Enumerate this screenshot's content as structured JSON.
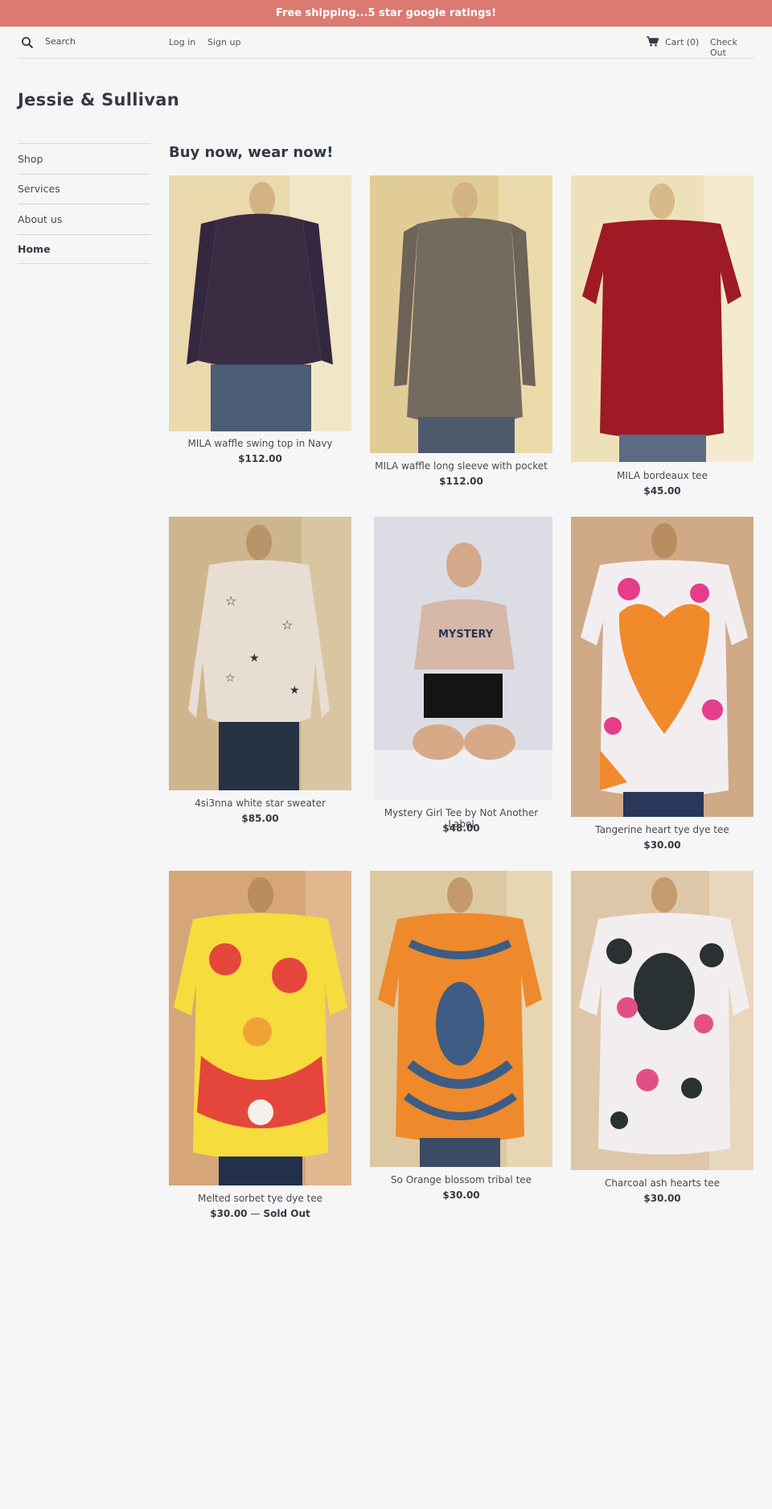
{
  "announcement": "Free shipping...5 star google ratings!",
  "header": {
    "search_label": "Search",
    "login": "Log in",
    "signup": "Sign up",
    "cart": "Cart (0)",
    "checkout": "Check Out",
    "icons": {
      "search": "search-icon",
      "cart": "cart-icon"
    }
  },
  "brand": "Jessie & Sullivan",
  "sidebar": {
    "items": [
      {
        "label": "Shop",
        "active": false
      },
      {
        "label": "Services",
        "active": false
      },
      {
        "label": "About us",
        "active": false
      },
      {
        "label": "Home",
        "active": true
      }
    ]
  },
  "main": {
    "heading": "Buy now, wear now!",
    "products": [
      {
        "title": "MILA waffle swing top in Navy",
        "price": "$112.00",
        "sold_out": ""
      },
      {
        "title": "MILA waffle long sleeve with pocket",
        "price": "$112.00",
        "sold_out": ""
      },
      {
        "title": "MILA bordeaux tee",
        "price": "$45.00",
        "sold_out": ""
      },
      {
        "title": "4si3nna white star sweater",
        "price": "$85.00",
        "sold_out": ""
      },
      {
        "title": "Mystery Girl Tee by Not Another Label",
        "price": "$48.00",
        "sold_out": ""
      },
      {
        "title": "Tangerine heart tye dye tee",
        "price": "$30.00",
        "sold_out": ""
      },
      {
        "title": "Melted sorbet tye dye tee",
        "price": "$30.00",
        "sold_out": "Sold Out"
      },
      {
        "title": "So Orange blossom tribal tee",
        "price": "$30.00",
        "sold_out": ""
      },
      {
        "title": "Charcoal ash hearts tee",
        "price": "$30.00",
        "sold_out": ""
      }
    ]
  },
  "colors": {
    "announcement_bg": "#da7a71",
    "text": "#333a45",
    "page_bg": "#f6f6f6"
  }
}
